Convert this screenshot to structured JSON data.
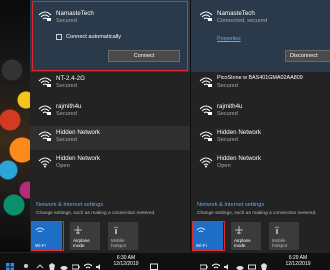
{
  "left": {
    "networks": [
      {
        "ssid": "NamasteTech",
        "status": "Secured",
        "expanded": true
      },
      {
        "ssid": "NT-2.4-2G",
        "status": "Secured"
      },
      {
        "ssid": "rajmith4u",
        "status": "Secured"
      },
      {
        "ssid": "Hidden Network",
        "status": "Secured"
      },
      {
        "ssid": "Hidden Network",
        "status": "Open"
      }
    ],
    "connect_auto_label": "Connect automatically",
    "connect_label": "Connect",
    "settings_title": "Network & Internet settings",
    "settings_desc": "Change settings, such as making a connection metered.",
    "tiles": [
      {
        "label": "Wi-Fi",
        "on": true
      },
      {
        "label": "Airplane mode",
        "on": false
      },
      {
        "label": "Mobile\nhotspot",
        "on": false
      }
    ],
    "clock": {
      "time": "6:30 AM",
      "date": "12/12/2019"
    }
  },
  "right": {
    "networks": [
      {
        "ssid": "NamasteTech",
        "status": "Connected, secured",
        "expanded": true
      },
      {
        "ssid": "PicoStone w BAS401GMA02AA809",
        "status": "Secured"
      },
      {
        "ssid": "rajmith4u",
        "status": "Secured"
      },
      {
        "ssid": "Hidden Network",
        "status": "Secured"
      },
      {
        "ssid": "Hidden Network",
        "status": "Open"
      }
    ],
    "properties_label": "Properties",
    "disconnect_label": "Disconnect",
    "settings_title": "Network & Internet settings",
    "settings_desc": "Change settings, such as making a connection metered.",
    "tiles": [
      {
        "label": "Wi-Fi",
        "on": true
      },
      {
        "label": "Airplane mode",
        "on": false
      },
      {
        "label": "Mobile\nhotspot",
        "on": false
      }
    ],
    "clock": {
      "time": "6:29 AM",
      "date": "12/12/2019"
    }
  },
  "colors": {
    "accent": "#1e6ec8",
    "highlight": "#e32a2a",
    "link": "#6aa9e8"
  }
}
